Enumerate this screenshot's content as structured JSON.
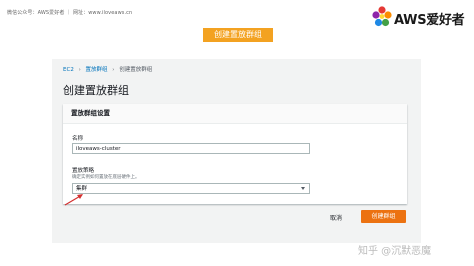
{
  "header": {
    "wechat_note": "微信公众号：AWS爱好者 ｜ 网址：www.iloveaws.cn",
    "logo_text": "AWS爱好者"
  },
  "slide": {
    "title": "创建置放群组"
  },
  "breadcrumb": {
    "items": [
      "EC2",
      "置放群组",
      "创建置放群组"
    ]
  },
  "page": {
    "title": "创建置放群组"
  },
  "panel": {
    "header": "置放群组设置",
    "name_label": "名称",
    "name_value": "iloveaws-cluster",
    "strategy_label": "置放策略",
    "strategy_desc": "确定实例如何置放在底层硬件上。",
    "strategy_value": "集群"
  },
  "actions": {
    "cancel_label": "取消",
    "create_label": "创建群组"
  },
  "watermark": {
    "text": "知乎 @沉默恶魔"
  },
  "colors": {
    "accent_orange": "#ec7211",
    "title_bg": "#f3a221",
    "link_blue": "#0073bb"
  }
}
